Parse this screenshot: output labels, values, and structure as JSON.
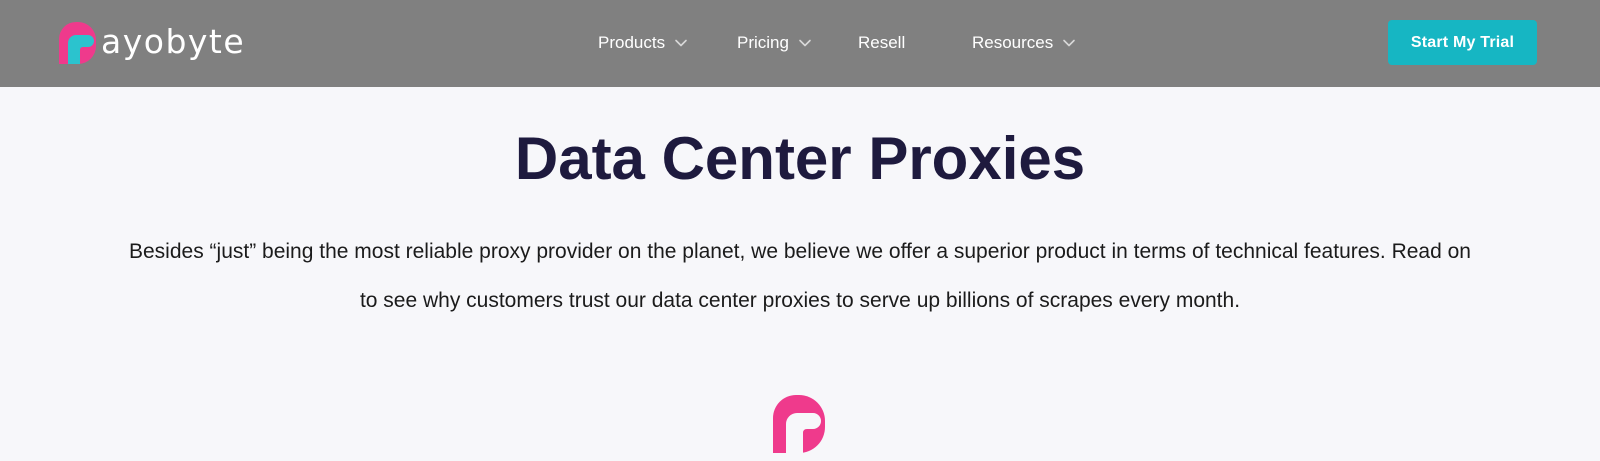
{
  "header": {
    "brand_name": "ayobyte",
    "nav": {
      "products": "Products",
      "pricing": "Pricing",
      "resell": "Resell",
      "resources": "Resources"
    },
    "cta_label": "Start My Trial"
  },
  "hero": {
    "title": "Data Center Proxies",
    "lines": [
      "Besides “just” being the most reliable proxy provider on the planet, we believe we offer a superior product in terms of technical features. Read on",
      "to see why customers trust our data center proxies to serve up billions of scrapes every month."
    ]
  },
  "icons": {
    "logo": "rayobyte-logo-icon",
    "dropdown": "chevron-down-icon"
  },
  "colors": {
    "header_bg": "#808080",
    "brand_pink": "#ef3a8c",
    "accent_teal": "#16b6c3",
    "page_bg": "#f7f7fa",
    "heading": "#1e1a3e"
  }
}
